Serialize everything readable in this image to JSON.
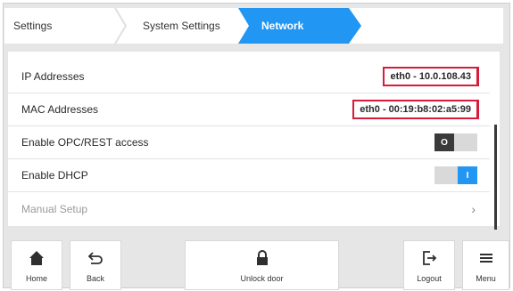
{
  "breadcrumb": {
    "items": [
      {
        "label": "Settings"
      },
      {
        "label": "System Settings"
      },
      {
        "label": "Network"
      }
    ],
    "active_color": "#2196f3"
  },
  "network_list": {
    "rows": [
      {
        "label": "IP Addresses",
        "value": "eth0 - 10.0.108.43"
      },
      {
        "label": "MAC Addresses",
        "value": "eth0 - 00:19:b8:02:a5:99"
      },
      {
        "label": "Enable OPC/REST access",
        "toggle_state": "O",
        "toggle_on": false
      },
      {
        "label": "Enable DHCP",
        "toggle_state": "I",
        "toggle_on": true
      },
      {
        "label": "Manual Setup",
        "chevron": "›"
      }
    ],
    "highlight_color": "#d81b3a"
  },
  "bottom_nav": {
    "home_label": "Home",
    "back_label": "Back",
    "unlock_label": "Unlock door",
    "logout_label": "Logout",
    "menu_label": "Menu"
  }
}
